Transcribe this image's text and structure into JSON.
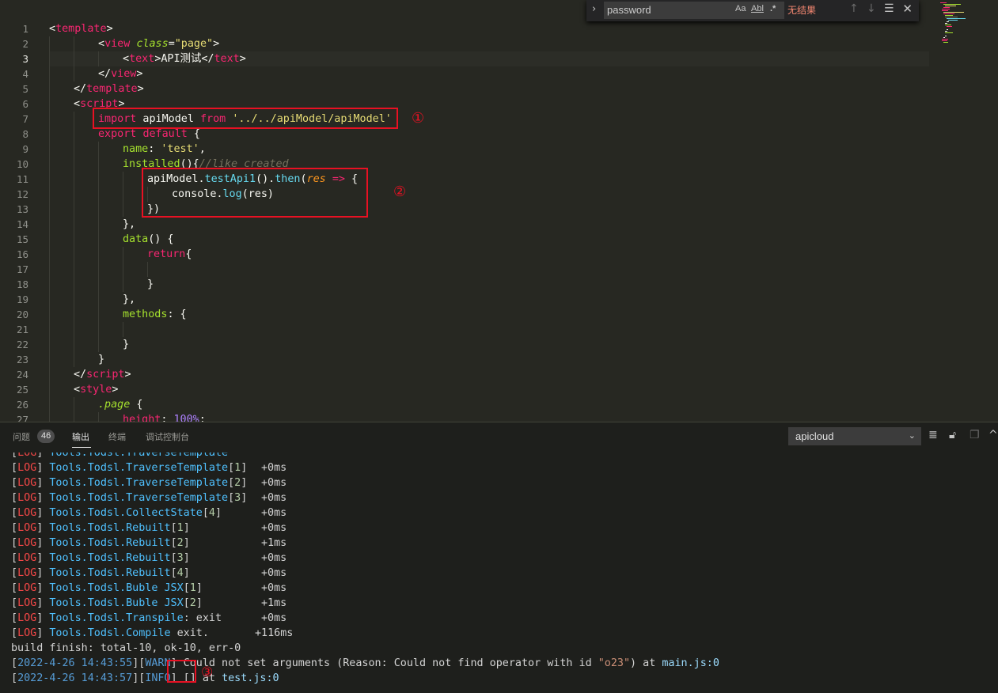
{
  "find_widget": {
    "query": "password",
    "match_case": "Aa",
    "whole_word": "Abl",
    "regex": ".*",
    "result": "无结果"
  },
  "editor": {
    "active_line": 3,
    "line_numbers": [
      "1",
      "2",
      "3",
      "4",
      "5",
      "6",
      "7",
      "8",
      "9",
      "10",
      "11",
      "12",
      "13",
      "14",
      "15",
      "16",
      "17",
      "18",
      "19",
      "20",
      "21",
      "22",
      "23",
      "24",
      "25",
      "26",
      "27"
    ],
    "lines": [
      {
        "indent": 0,
        "tokens": [
          [
            "pun",
            "<"
          ],
          [
            "tag",
            "template"
          ],
          [
            "pun",
            ">"
          ]
        ]
      },
      {
        "indent": 2,
        "tokens": [
          [
            "pun",
            "<"
          ],
          [
            "tag",
            "view"
          ],
          [
            "pun",
            " "
          ],
          [
            "attr",
            "class"
          ],
          [
            "pun",
            "="
          ],
          [
            "str",
            "\"page\""
          ],
          [
            "pun",
            ">"
          ]
        ]
      },
      {
        "indent": 3,
        "tokens": [
          [
            "pun",
            "<"
          ],
          [
            "tag",
            "text"
          ],
          [
            "pun",
            ">API测试</"
          ],
          [
            "tag",
            "text"
          ],
          [
            "pun",
            ">"
          ]
        ]
      },
      {
        "indent": 2,
        "tokens": [
          [
            "pun",
            "</"
          ],
          [
            "tag",
            "view"
          ],
          [
            "pun",
            ">"
          ]
        ]
      },
      {
        "indent": 1,
        "tokens": [
          [
            "pun",
            "</"
          ],
          [
            "tag",
            "template"
          ],
          [
            "pun",
            ">"
          ]
        ]
      },
      {
        "indent": 1,
        "tokens": [
          [
            "pun",
            "<"
          ],
          [
            "tag",
            "script"
          ],
          [
            "pun",
            ">"
          ]
        ]
      },
      {
        "indent": 2,
        "tokens": [
          [
            "kw",
            "import"
          ],
          [
            "pun",
            " apiModel "
          ],
          [
            "kw",
            "from"
          ],
          [
            "pun",
            " "
          ],
          [
            "str",
            "'../../apiModel/apiModel'"
          ]
        ]
      },
      {
        "indent": 2,
        "tokens": [
          [
            "kw",
            "export"
          ],
          [
            "pun",
            " "
          ],
          [
            "kw",
            "default"
          ],
          [
            "pun",
            " {"
          ]
        ]
      },
      {
        "indent": 3,
        "tokens": [
          [
            "fn",
            "name"
          ],
          [
            "pun",
            ": "
          ],
          [
            "str",
            "'test'"
          ],
          [
            "pun",
            ","
          ]
        ]
      },
      {
        "indent": 3,
        "tokens": [
          [
            "fn",
            "installed"
          ],
          [
            "pun",
            "(){"
          ],
          [
            "cmt",
            "//like created"
          ]
        ]
      },
      {
        "indent": 4,
        "tokens": [
          [
            "pun",
            "apiModel."
          ],
          [
            "mth",
            "testApi1"
          ],
          [
            "pun",
            "()."
          ],
          [
            "mth",
            "then"
          ],
          [
            "pun",
            "("
          ],
          [
            "prm",
            "res"
          ],
          [
            "pun",
            " "
          ],
          [
            "kw",
            "=>"
          ],
          [
            "pun",
            " {"
          ]
        ]
      },
      {
        "indent": 5,
        "tokens": [
          [
            "pun",
            "console."
          ],
          [
            "mth",
            "log"
          ],
          [
            "pun",
            "(res)"
          ]
        ]
      },
      {
        "indent": 4,
        "tokens": [
          [
            "pun",
            "})"
          ]
        ]
      },
      {
        "indent": 3,
        "tokens": [
          [
            "pun",
            "},"
          ]
        ]
      },
      {
        "indent": 3,
        "tokens": [
          [
            "fn",
            "data"
          ],
          [
            "pun",
            "() {"
          ]
        ]
      },
      {
        "indent": 4,
        "tokens": [
          [
            "kw",
            "return"
          ],
          [
            "pun",
            "{"
          ]
        ]
      },
      {
        "indent": 5,
        "tokens": []
      },
      {
        "indent": 4,
        "tokens": [
          [
            "pun",
            "}"
          ]
        ]
      },
      {
        "indent": 3,
        "tokens": [
          [
            "pun",
            "},"
          ]
        ]
      },
      {
        "indent": 3,
        "tokens": [
          [
            "fn",
            "methods"
          ],
          [
            "pun",
            ": {"
          ]
        ]
      },
      {
        "indent": 4,
        "tokens": []
      },
      {
        "indent": 3,
        "tokens": [
          [
            "pun",
            "}"
          ]
        ]
      },
      {
        "indent": 2,
        "tokens": [
          [
            "pun",
            "}"
          ]
        ]
      },
      {
        "indent": 1,
        "tokens": [
          [
            "pun",
            "</"
          ],
          [
            "tag",
            "script"
          ],
          [
            "pun",
            ">"
          ]
        ]
      },
      {
        "indent": 1,
        "tokens": [
          [
            "pun",
            "<"
          ],
          [
            "tag",
            "style"
          ],
          [
            "pun",
            ">"
          ]
        ]
      },
      {
        "indent": 2,
        "tokens": [
          [
            "cls",
            ".page"
          ],
          [
            "pun",
            " {"
          ]
        ]
      },
      {
        "indent": 3,
        "tokens": [
          [
            "kw",
            "height"
          ],
          [
            "pun",
            ": "
          ],
          [
            "num",
            "100%"
          ],
          [
            "pun",
            ";"
          ]
        ]
      }
    ],
    "annotations": [
      "①",
      "②",
      "③"
    ]
  },
  "panel": {
    "tabs": [
      {
        "label": "问题",
        "badge": "46"
      },
      {
        "label": "输出"
      },
      {
        "label": "终端"
      },
      {
        "label": "调试控制台"
      }
    ],
    "active_tab": "输出",
    "channel": "apicloud"
  },
  "output": {
    "logs": [
      {
        "name": "Tools.Todsl.TraverseTemplate",
        "idx": "1",
        "suffix": "",
        "time": "+0ms"
      },
      {
        "name": "Tools.Todsl.TraverseTemplate",
        "idx": "2",
        "suffix": "",
        "time": "+0ms"
      },
      {
        "name": "Tools.Todsl.TraverseTemplate",
        "idx": "3",
        "suffix": "",
        "time": "+0ms"
      },
      {
        "name": "Tools.Todsl.CollectState",
        "idx": "4",
        "suffix": "",
        "time": "+0ms"
      },
      {
        "name": "Tools.Todsl.Rebuilt",
        "idx": "1",
        "suffix": "",
        "time": "+0ms"
      },
      {
        "name": "Tools.Todsl.Rebuilt",
        "idx": "2",
        "suffix": "",
        "time": "+1ms"
      },
      {
        "name": "Tools.Todsl.Rebuilt",
        "idx": "3",
        "suffix": "",
        "time": "+0ms"
      },
      {
        "name": "Tools.Todsl.Rebuilt",
        "idx": "4",
        "suffix": "",
        "time": "+0ms"
      },
      {
        "name": "Tools.Todsl.Buble JSX",
        "idx": "1",
        "suffix": "",
        "time": "+0ms"
      },
      {
        "name": "Tools.Todsl.Buble JSX",
        "idx": "2",
        "suffix": "",
        "time": "+1ms"
      },
      {
        "name": "Tools.Todsl.Transpile",
        "idx": "",
        "suffix": ": exit",
        "time": "+0ms"
      },
      {
        "name": "Tools.Todsl.Compile",
        "idx": "",
        "suffix": " exit.",
        "time": "+116ms"
      }
    ],
    "log_tag": "LOG",
    "build": "build finish: total-10, ok-10, err-0",
    "warn": {
      "date": "2022-4-26 14:43:55",
      "level": "WARN",
      "msg": " Could not set arguments (Reason: Could not find operator with id ",
      "id": "\"o23\"",
      "at": ") at ",
      "file": "main.js:0"
    },
    "info": {
      "date": "2022-4-26 14:43:57",
      "level": "INFO",
      "msg": " [] ",
      "at": "at ",
      "file": "test.js:0"
    }
  }
}
